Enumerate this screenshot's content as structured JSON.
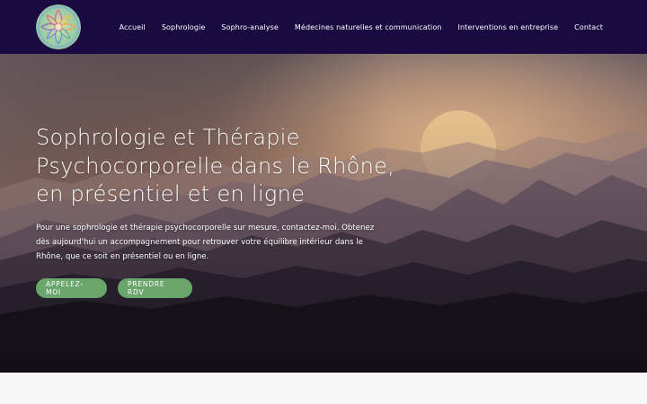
{
  "header": {
    "logo": "mandala-logo",
    "nav": [
      "Accueil",
      "Sophrologie",
      "Sophro-analyse",
      "Médecines naturelles et communication",
      "Interventions en entreprise",
      "Contact"
    ]
  },
  "hero": {
    "title": "Sophrologie et Thérapie Psychocorporelle dans le Rhône, en présentiel et en ligne",
    "text": "Pour une sophrologie et thérapie psychocorporelle sur mesure, contactez-moi. Obtenez dès aujourd'hui un accompagnement pour retrouver votre équilibre intérieur dans le Rhône, que ce soit en présentiel ou en ligne.",
    "buttons": {
      "call": "APPELEZ-MOI",
      "appointment": "PRENDRE RDV"
    }
  },
  "colors": {
    "header_bg": "#1b0a42",
    "button_green": "#6aa66b",
    "sun": "#f5cc97",
    "sky_top": "#7a6868",
    "sky_horizon": "#f3aa82"
  }
}
